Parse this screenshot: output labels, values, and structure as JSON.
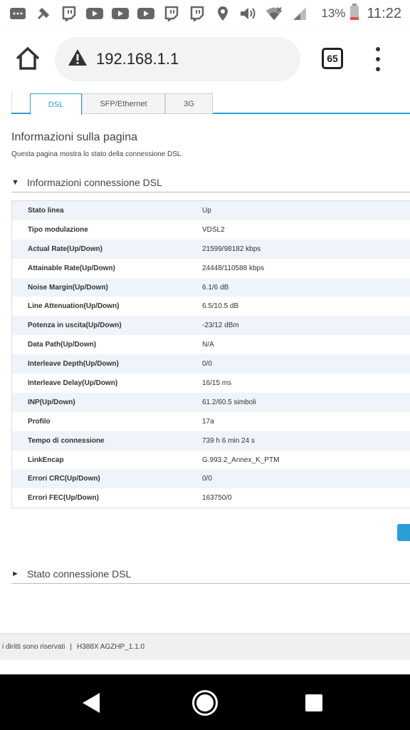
{
  "status_bar": {
    "icons": [
      "chat-icon",
      "pin-icon",
      "twitch-icon",
      "youtube-icon",
      "youtube-icon",
      "youtube-icon",
      "twitch-icon",
      "twitch-icon",
      "location-icon",
      "volume-icon",
      "wifi-icon",
      "signal-icon"
    ],
    "battery": "13%",
    "time": "11:22"
  },
  "browser": {
    "url": "192.168.1.1",
    "tab_count": "65"
  },
  "tabs": [
    {
      "label": "DSL",
      "active": true
    },
    {
      "label": "SFP/Ethernet",
      "active": false
    },
    {
      "label": "3G",
      "active": false
    }
  ],
  "page": {
    "title": "Informazioni sulla pagina",
    "description": "Questa pagina mostra lo stato della connessione DSL."
  },
  "section_dsl_info": {
    "label": "Informazioni connessione DSL",
    "rows": [
      {
        "label": "Stato linea",
        "value": "Up"
      },
      {
        "label": "Tipo modulazione",
        "value": "VDSL2"
      },
      {
        "label": "Actual Rate(Up/Down)",
        "value": "21599/98182 kbps"
      },
      {
        "label": "Attainable Rate(Up/Down)",
        "value": "24448/110588 kbps"
      },
      {
        "label": "Noise Margin(Up/Down)",
        "value": "6.1/6 dB"
      },
      {
        "label": "Line Attenuation(Up/Down)",
        "value": "6.5/10.5 dB"
      },
      {
        "label": "Potenza in uscita(Up/Down)",
        "value": "-23/12 dBm"
      },
      {
        "label": "Data Path(Up/Down)",
        "value": "N/A"
      },
      {
        "label": "Interleave Depth(Up/Down)",
        "value": "0/0"
      },
      {
        "label": "Interleave Delay(Up/Down)",
        "value": "16/15 ms"
      },
      {
        "label": "INP(Up/Down)",
        "value": "61.2/60.5 simboli"
      },
      {
        "label": "Profilo",
        "value": "17a"
      },
      {
        "label": "Tempo di connessione",
        "value": "739 h 6 min 24 s"
      },
      {
        "label": "LinkEncap",
        "value": "G.993.2_Annex_K_PTM"
      },
      {
        "label": "Errori CRC(Up/Down)",
        "value": "0/0"
      },
      {
        "label": "Errori FEC(Up/Down)",
        "value": "163750/0"
      }
    ]
  },
  "section_dsl_status": {
    "label": "Stato connessione DSL"
  },
  "footer": {
    "rights": "i diritti sono riservati",
    "separator": "|",
    "firmware": "H388X AGZHP_1.1.0"
  },
  "colors": {
    "accent": "#2a9fd6",
    "row_alt": "#eef4fa"
  }
}
